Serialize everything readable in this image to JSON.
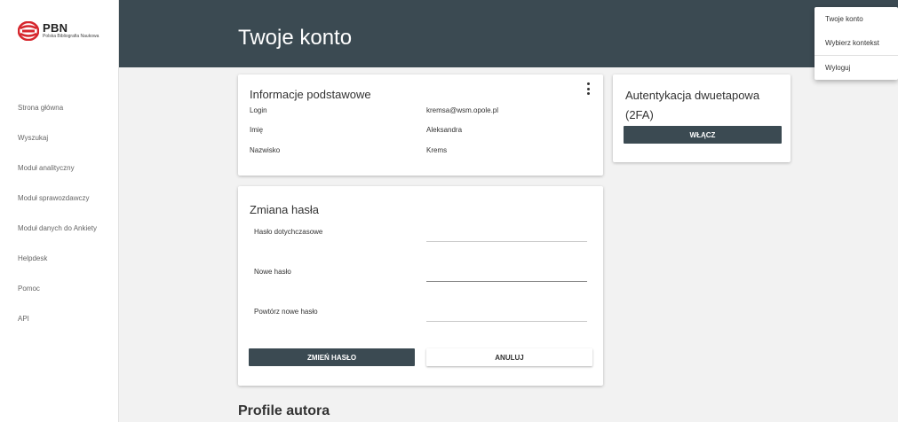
{
  "logo": {
    "title": "PBN",
    "subtitle": "Polska Bibliografia Naukowa",
    "icon": "pbn-logo-icon"
  },
  "sidebar": {
    "items": [
      {
        "label": "Strona główna"
      },
      {
        "label": "Wyszukaj"
      },
      {
        "label": "Moduł analityczny"
      },
      {
        "label": "Moduł sprawozdawczy"
      },
      {
        "label": "Moduł danych do Ankiety"
      },
      {
        "label": "Helpdesk"
      },
      {
        "label": "Pomoc"
      },
      {
        "label": "API"
      }
    ]
  },
  "header": {
    "title": "Twoje konto"
  },
  "menu": {
    "items": [
      {
        "label": "Twoje konto"
      },
      {
        "label": "Wybierz kontekst"
      },
      {
        "label": "Wyloguj"
      }
    ]
  },
  "info": {
    "title": "Informacje podstawowe",
    "rows": [
      {
        "label": "Login",
        "value": "kremsa@wsm.opole.pl"
      },
      {
        "label": "Imię",
        "value": "Aleksandra"
      },
      {
        "label": "Nazwisko",
        "value": "Krems"
      }
    ],
    "menu_icon": "kebab-menu-icon"
  },
  "tfa": {
    "title": "Autentykacja dwuetapowa (2FA)",
    "button": "WŁĄCZ"
  },
  "password": {
    "title": "Zmiana hasła",
    "fields": [
      {
        "label": "Hasło dotychczasowe",
        "value": ""
      },
      {
        "label": "Nowe hasło",
        "value": ""
      },
      {
        "label": "Powtórz nowe hasło",
        "value": ""
      }
    ],
    "submit": "ZMIEŃ HASŁO",
    "cancel": "ANULUJ"
  },
  "profiles": {
    "title": "Profile autora"
  },
  "colors": {
    "header": "#3b4a52",
    "background": "#f2f2f2",
    "logo_red": "#d6262d"
  }
}
